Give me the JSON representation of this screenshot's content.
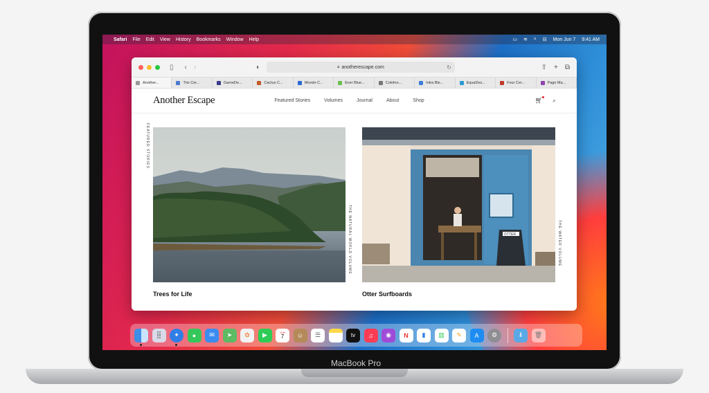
{
  "menubar": {
    "app": "Safari",
    "items": [
      "File",
      "Edit",
      "View",
      "History",
      "Bookmarks",
      "Window",
      "Help"
    ],
    "date": "Mon Jun 7",
    "time": "9:41 AM"
  },
  "safari": {
    "url": "anotherescape.com",
    "tabs": [
      {
        "label": "Another...",
        "color": "#999999"
      },
      {
        "label": "Trio Cer...",
        "color": "#4a7bd0"
      },
      {
        "label": "GameDe...",
        "color": "#3a3a8a"
      },
      {
        "label": "Cactus C...",
        "color": "#c05a2a"
      },
      {
        "label": "Mondo C...",
        "color": "#2a6ad0"
      },
      {
        "label": "Ever Blue...",
        "color": "#6abf4b"
      },
      {
        "label": "Colofon...",
        "color": "#777777"
      },
      {
        "label": "Intra Ble...",
        "color": "#3b7dd8"
      },
      {
        "label": "EquaDes...",
        "color": "#2a9ad0"
      },
      {
        "label": "Four Cer...",
        "color": "#c0392b"
      },
      {
        "label": "Page Ma...",
        "color": "#8e44ad"
      }
    ]
  },
  "site": {
    "logo": "Another Escape",
    "nav": [
      "Featured Stories",
      "Volumes",
      "Journal",
      "About",
      "Shop"
    ],
    "featured_label": "FEATURED STORIES",
    "left_volume": "THE NATURAL WORLD VOLUME",
    "right_volume": "THE WATER VOLUME",
    "card_left_title": "Trees for Life",
    "card_right_title": "Otter Surfboards",
    "sign_text": "OTTER"
  },
  "laptop": {
    "label": "MacBook Pro"
  },
  "dock": {
    "apps": [
      {
        "name": "finder-icon",
        "color": "#3d8ee6",
        "running": true
      },
      {
        "name": "launchpad-icon",
        "color": "#d9d9e8",
        "running": false
      },
      {
        "name": "safari-icon",
        "color": "#2f7ee6",
        "running": true
      },
      {
        "name": "messages-icon",
        "color": "#34c759",
        "running": false
      },
      {
        "name": "mail-icon",
        "color": "#3a8cf0",
        "running": false
      },
      {
        "name": "maps-icon",
        "color": "#5dbb63",
        "running": false
      },
      {
        "name": "photos-icon",
        "color": "#f2f2f2",
        "running": false
      },
      {
        "name": "facetime-icon",
        "color": "#2ecc55",
        "running": false
      },
      {
        "name": "calendar-icon",
        "color": "#ffffff",
        "running": false
      },
      {
        "name": "contacts-icon",
        "color": "#b58a5a",
        "running": false
      },
      {
        "name": "reminders-icon",
        "color": "#ffffff",
        "running": false
      },
      {
        "name": "notes-icon",
        "color": "#ffd84a",
        "running": false
      },
      {
        "name": "tv-icon",
        "color": "#111111",
        "running": false
      },
      {
        "name": "music-icon",
        "color": "#fa3c55",
        "running": false
      },
      {
        "name": "podcasts-icon",
        "color": "#a04bd8",
        "running": false
      },
      {
        "name": "news-icon",
        "color": "#ffffff",
        "running": false
      },
      {
        "name": "keynote-icon",
        "color": "#ffffff",
        "running": false
      },
      {
        "name": "numbers-icon",
        "color": "#ffffff",
        "running": false
      },
      {
        "name": "pages-icon",
        "color": "#f6a11f",
        "running": false
      },
      {
        "name": "app-store-icon",
        "color": "#1e8cf2",
        "running": false
      },
      {
        "name": "system-preferences-icon",
        "color": "#8e8e93",
        "running": false
      }
    ],
    "calendar_month": "JUN",
    "calendar_day": "7",
    "tv_label": "tv"
  }
}
